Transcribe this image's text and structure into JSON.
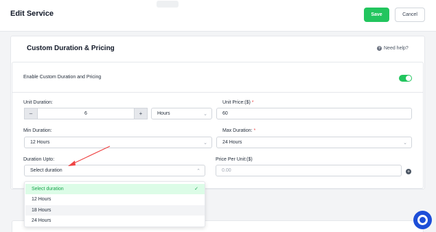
{
  "header": {
    "title": "Edit Service",
    "save_label": "Save",
    "cancel_label": "Cancel"
  },
  "section": {
    "title": "Custom Duration & Pricing",
    "help_label": "Need help?"
  },
  "toggle": {
    "label": "Enable Custom Duration and Pricing",
    "enabled": true
  },
  "fields": {
    "unit_duration_label": "Unit Duration:",
    "unit_duration_value": "6",
    "unit_duration_unit": "Hours",
    "unit_price_label": "Unit Price:($)",
    "unit_price_value": "60",
    "min_duration_label": "Min Duration:",
    "min_duration_value": "12 Hours",
    "max_duration_label": "Max Duration:",
    "max_duration_value": "24 Hours",
    "duration_upto_label": "Duration Upto:",
    "duration_upto_placeholder": "Select duration",
    "price_per_unit_label": "Price Per Unit:($)",
    "price_per_unit_placeholder": "0.00",
    "required_marker": "*"
  },
  "dropdown": {
    "options": [
      "Select duration",
      "12 Hours",
      "18 Hours",
      "24 Hours"
    ],
    "selected_index": 0,
    "hover_index": 2
  },
  "colors": {
    "accent": "#22c55e",
    "required": "#ef4444",
    "support": "#1d4ed8"
  }
}
